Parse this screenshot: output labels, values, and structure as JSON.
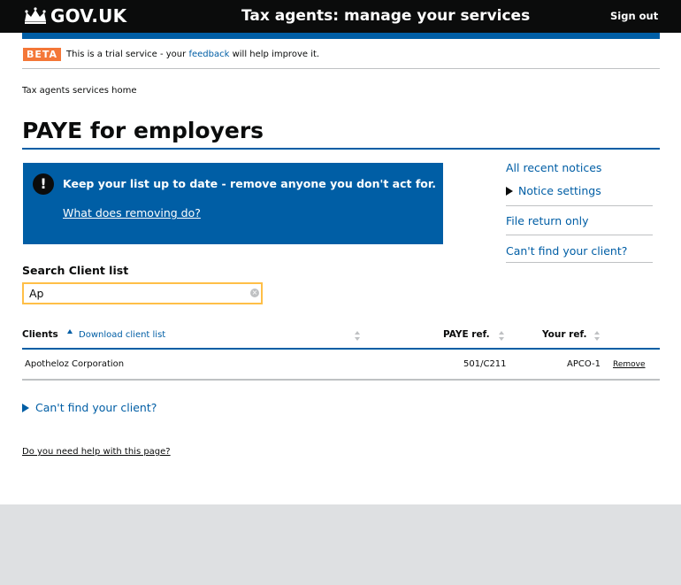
{
  "header": {
    "logo_text": "GOV.UK",
    "service_name": "Tax agents: manage your services",
    "signout_label": "Sign out"
  },
  "beta": {
    "tag": "BETA",
    "text_before": "This is a trial service - your",
    "feedback_link": "feedback",
    "text_after": "will help improve it."
  },
  "breadcrumb": "Tax agents services home",
  "page_title": "PAYE for employers",
  "notice": {
    "icon": "!",
    "heading": "Keep your list up to date - remove anyone you don't act for.",
    "link": "What does removing do?"
  },
  "sidebar": {
    "recent_notices": "All recent notices",
    "notice_settings": "Notice settings",
    "file_return_only": "File return only",
    "cant_find": "Can't find your client?"
  },
  "search": {
    "label": "Search Client list",
    "value": "Ap"
  },
  "table": {
    "headers": {
      "clients": "Clients",
      "download": "Download client list",
      "paye_ref": "PAYE ref.",
      "your_ref": "Your ref."
    },
    "rows": [
      {
        "client": "Apotheloz Corporation",
        "paye_ref": "501/C211",
        "your_ref": "APCO-1",
        "action": "Remove"
      }
    ]
  },
  "cant_find_client": "Can't find your client?",
  "help_link": "Do you need help with this page?",
  "colors": {
    "header_bg": "#0b0c0c",
    "brand_blue": "#005ea5",
    "beta_orange": "#f47738",
    "focus_yellow": "#ffbf47",
    "footer_grey": "#dee0e2"
  }
}
